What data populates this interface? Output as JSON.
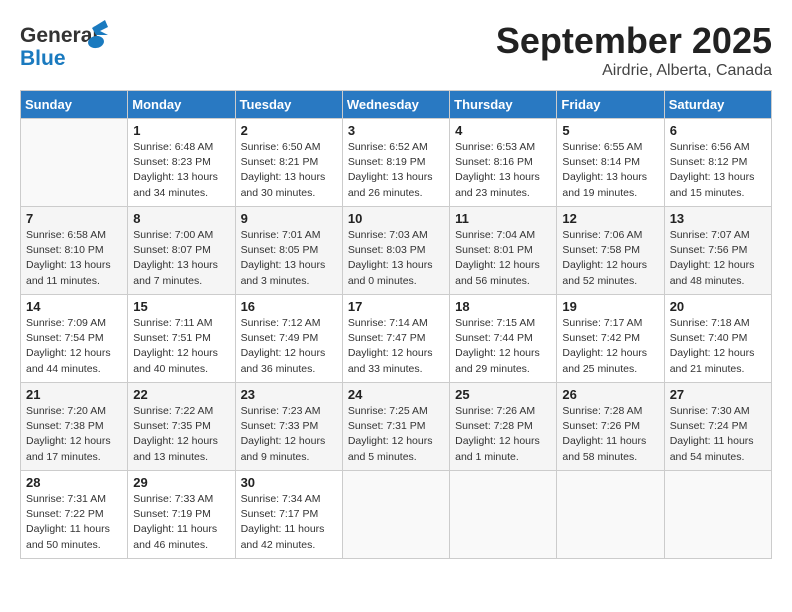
{
  "header": {
    "logo_general": "General",
    "logo_blue": "Blue",
    "month": "September 2025",
    "location": "Airdrie, Alberta, Canada"
  },
  "weekdays": [
    "Sunday",
    "Monday",
    "Tuesday",
    "Wednesday",
    "Thursday",
    "Friday",
    "Saturday"
  ],
  "weeks": [
    [
      {
        "day": "",
        "info": ""
      },
      {
        "day": "1",
        "info": "Sunrise: 6:48 AM\nSunset: 8:23 PM\nDaylight: 13 hours\nand 34 minutes."
      },
      {
        "day": "2",
        "info": "Sunrise: 6:50 AM\nSunset: 8:21 PM\nDaylight: 13 hours\nand 30 minutes."
      },
      {
        "day": "3",
        "info": "Sunrise: 6:52 AM\nSunset: 8:19 PM\nDaylight: 13 hours\nand 26 minutes."
      },
      {
        "day": "4",
        "info": "Sunrise: 6:53 AM\nSunset: 8:16 PM\nDaylight: 13 hours\nand 23 minutes."
      },
      {
        "day": "5",
        "info": "Sunrise: 6:55 AM\nSunset: 8:14 PM\nDaylight: 13 hours\nand 19 minutes."
      },
      {
        "day": "6",
        "info": "Sunrise: 6:56 AM\nSunset: 8:12 PM\nDaylight: 13 hours\nand 15 minutes."
      }
    ],
    [
      {
        "day": "7",
        "info": "Sunrise: 6:58 AM\nSunset: 8:10 PM\nDaylight: 13 hours\nand 11 minutes."
      },
      {
        "day": "8",
        "info": "Sunrise: 7:00 AM\nSunset: 8:07 PM\nDaylight: 13 hours\nand 7 minutes."
      },
      {
        "day": "9",
        "info": "Sunrise: 7:01 AM\nSunset: 8:05 PM\nDaylight: 13 hours\nand 3 minutes."
      },
      {
        "day": "10",
        "info": "Sunrise: 7:03 AM\nSunset: 8:03 PM\nDaylight: 13 hours\nand 0 minutes."
      },
      {
        "day": "11",
        "info": "Sunrise: 7:04 AM\nSunset: 8:01 PM\nDaylight: 12 hours\nand 56 minutes."
      },
      {
        "day": "12",
        "info": "Sunrise: 7:06 AM\nSunset: 7:58 PM\nDaylight: 12 hours\nand 52 minutes."
      },
      {
        "day": "13",
        "info": "Sunrise: 7:07 AM\nSunset: 7:56 PM\nDaylight: 12 hours\nand 48 minutes."
      }
    ],
    [
      {
        "day": "14",
        "info": "Sunrise: 7:09 AM\nSunset: 7:54 PM\nDaylight: 12 hours\nand 44 minutes."
      },
      {
        "day": "15",
        "info": "Sunrise: 7:11 AM\nSunset: 7:51 PM\nDaylight: 12 hours\nand 40 minutes."
      },
      {
        "day": "16",
        "info": "Sunrise: 7:12 AM\nSunset: 7:49 PM\nDaylight: 12 hours\nand 36 minutes."
      },
      {
        "day": "17",
        "info": "Sunrise: 7:14 AM\nSunset: 7:47 PM\nDaylight: 12 hours\nand 33 minutes."
      },
      {
        "day": "18",
        "info": "Sunrise: 7:15 AM\nSunset: 7:44 PM\nDaylight: 12 hours\nand 29 minutes."
      },
      {
        "day": "19",
        "info": "Sunrise: 7:17 AM\nSunset: 7:42 PM\nDaylight: 12 hours\nand 25 minutes."
      },
      {
        "day": "20",
        "info": "Sunrise: 7:18 AM\nSunset: 7:40 PM\nDaylight: 12 hours\nand 21 minutes."
      }
    ],
    [
      {
        "day": "21",
        "info": "Sunrise: 7:20 AM\nSunset: 7:38 PM\nDaylight: 12 hours\nand 17 minutes."
      },
      {
        "day": "22",
        "info": "Sunrise: 7:22 AM\nSunset: 7:35 PM\nDaylight: 12 hours\nand 13 minutes."
      },
      {
        "day": "23",
        "info": "Sunrise: 7:23 AM\nSunset: 7:33 PM\nDaylight: 12 hours\nand 9 minutes."
      },
      {
        "day": "24",
        "info": "Sunrise: 7:25 AM\nSunset: 7:31 PM\nDaylight: 12 hours\nand 5 minutes."
      },
      {
        "day": "25",
        "info": "Sunrise: 7:26 AM\nSunset: 7:28 PM\nDaylight: 12 hours\nand 1 minute."
      },
      {
        "day": "26",
        "info": "Sunrise: 7:28 AM\nSunset: 7:26 PM\nDaylight: 11 hours\nand 58 minutes."
      },
      {
        "day": "27",
        "info": "Sunrise: 7:30 AM\nSunset: 7:24 PM\nDaylight: 11 hours\nand 54 minutes."
      }
    ],
    [
      {
        "day": "28",
        "info": "Sunrise: 7:31 AM\nSunset: 7:22 PM\nDaylight: 11 hours\nand 50 minutes."
      },
      {
        "day": "29",
        "info": "Sunrise: 7:33 AM\nSunset: 7:19 PM\nDaylight: 11 hours\nand 46 minutes."
      },
      {
        "day": "30",
        "info": "Sunrise: 7:34 AM\nSunset: 7:17 PM\nDaylight: 11 hours\nand 42 minutes."
      },
      {
        "day": "",
        "info": ""
      },
      {
        "day": "",
        "info": ""
      },
      {
        "day": "",
        "info": ""
      },
      {
        "day": "",
        "info": ""
      }
    ]
  ]
}
